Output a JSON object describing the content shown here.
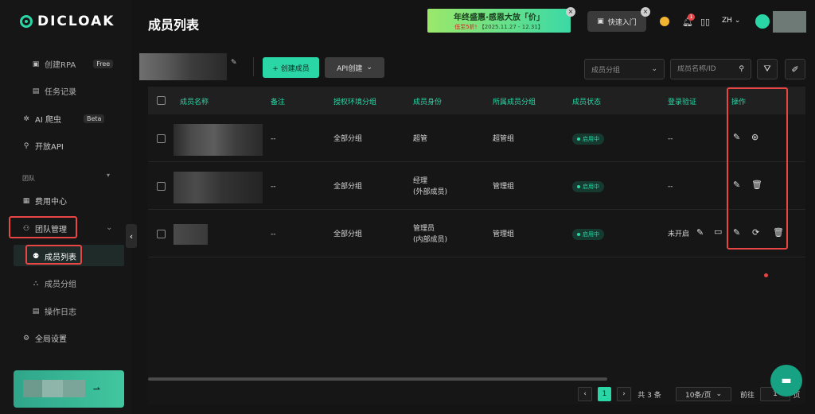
{
  "brand": {
    "name": "DICLOAK"
  },
  "sidebar": {
    "items": [
      {
        "label": "创建RPA",
        "icon": "rpa-icon",
        "badge": "Free"
      },
      {
        "label": "任务记录",
        "icon": "task-log-icon"
      },
      {
        "label": "AI 爬虫",
        "icon": "ai-crawler-icon",
        "badge": "Beta"
      },
      {
        "label": "开放API",
        "icon": "api-icon"
      },
      {
        "label": "费用中心",
        "icon": "billing-icon"
      },
      {
        "label": "团队管理",
        "icon": "team-icon"
      },
      {
        "label": "成员列表",
        "icon": "member-list-icon"
      },
      {
        "label": "成员分组",
        "icon": "member-group-icon"
      },
      {
        "label": "操作日志",
        "icon": "operation-log-icon"
      },
      {
        "label": "全局设置",
        "icon": "settings-icon"
      }
    ],
    "section_team": "团队"
  },
  "header": {
    "title": "成员列表",
    "promo_line1": "年终盛惠·感恩大放「价」",
    "promo_line2_red": "低至5折!",
    "promo_line2": " 【2025.11.27 - 12.31】",
    "quick_start": "快速入门",
    "lang": "ZH"
  },
  "toolbar": {
    "create_member": "+ 创建成员",
    "api_create": "API创建",
    "group_select_placeholder": "成员分组",
    "search_placeholder": "成员名称/ID"
  },
  "table": {
    "headers": [
      "成员名称",
      "备注",
      "授权环境分组",
      "成员身份",
      "所属成员分组",
      "成员状态",
      "登录验证",
      "操作"
    ],
    "rows": [
      {
        "remark": "--",
        "env_group": "全部分组",
        "role_line1": "超管",
        "role_line2": "",
        "member_group": "超管组",
        "status": "启用中",
        "login_verify": "--"
      },
      {
        "remark": "--",
        "env_group": "全部分组",
        "role_line1": "经理",
        "role_line2": "(外部成员)",
        "member_group": "管理组",
        "status": "启用中",
        "login_verify": "--"
      },
      {
        "remark": "--",
        "env_group": "全部分组",
        "role_line1": "管理员",
        "role_line2": "(内部成员)",
        "member_group": "管理组",
        "status": "启用中",
        "login_verify": "未开启"
      }
    ]
  },
  "pagination": {
    "current_page": "1",
    "total": "共 3 条",
    "page_size": "10条/页",
    "goto_label": "前往",
    "goto_value": "1",
    "page_suffix": "页"
  },
  "colors": {
    "accent": "#2ad6a5",
    "highlight": "#e84545",
    "background": "#141414"
  }
}
